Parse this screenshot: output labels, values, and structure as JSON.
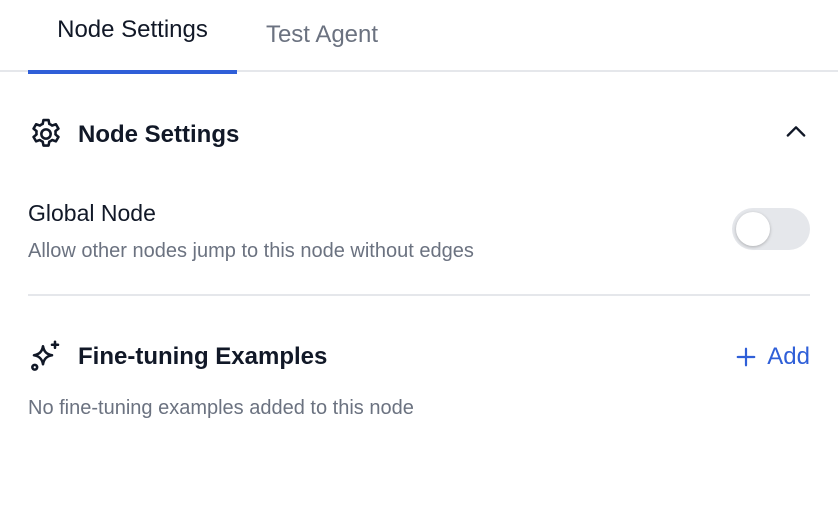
{
  "tabs": [
    {
      "label": "Node Settings",
      "active": true
    },
    {
      "label": "Test Agent",
      "active": false
    }
  ],
  "node_settings": {
    "title": "Node Settings",
    "icon": "gear-icon",
    "collapse_icon": "chevron-up-icon",
    "global_node": {
      "title": "Global Node",
      "description": "Allow other nodes jump to this node without edges",
      "enabled": false
    }
  },
  "fine_tuning": {
    "title": "Fine-tuning Examples",
    "icon": "sparkles-icon",
    "add_label": "Add",
    "empty_text": "No fine-tuning examples added to this node"
  },
  "colors": {
    "accent": "#2f5fd8",
    "muted_text": "#6b7280",
    "divider": "#e5e7eb",
    "toggle_off": "#e5e7eb"
  }
}
